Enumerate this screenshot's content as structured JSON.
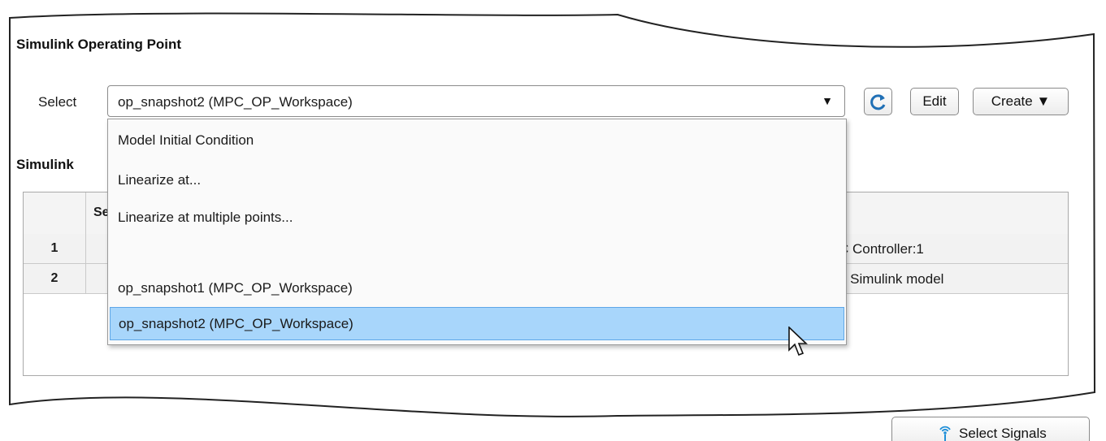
{
  "section": {
    "operating_point_title": "Simulink Operating Point",
    "io_title_partial": "Simulink"
  },
  "select": {
    "label": "Select",
    "current_value": "op_snapshot2 (MPC_OP_Workspace)",
    "arrow": "▼"
  },
  "buttons": {
    "refresh_icon": "refresh-icon",
    "edit_label": "Edit",
    "create_label": "Create ▼",
    "select_signals_label": "Select Signals",
    "signal_icon": "signal-antenna-icon"
  },
  "dropdown": {
    "items": [
      "Model Initial Condition",
      "Linearize at...",
      "Linearize at multiple points...",
      "",
      "op_snapshot1 (MPC_OP_Workspace)",
      "op_snapshot2 (MPC_OP_Workspace)"
    ],
    "selected_index": 5
  },
  "table": {
    "header_partial": "Se",
    "rows": [
      {
        "index": "1",
        "right_text": "C Controller:1"
      },
      {
        "index": "2",
        "right_text": "e Simulink model"
      }
    ]
  },
  "colors": {
    "selection_fill": "#a8d6fb",
    "selection_border": "#5ea7e8",
    "refresh_icon": "#1f6fb5"
  }
}
